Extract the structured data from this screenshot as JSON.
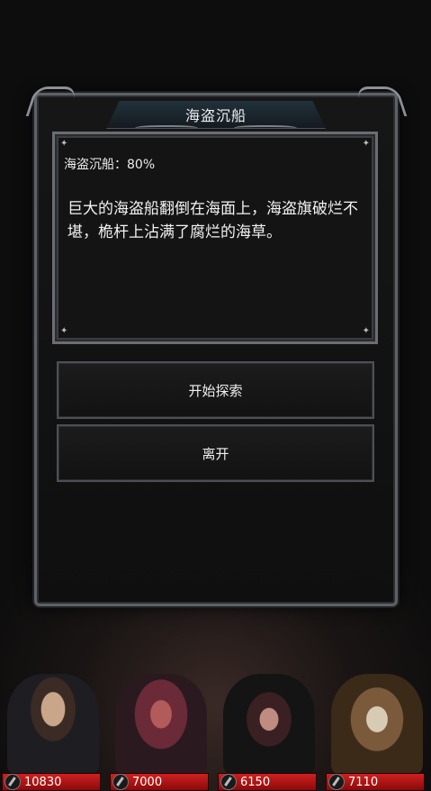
{
  "dialog": {
    "title": "海盗沉船",
    "rate_line": "海盗沉船：80%",
    "description": "巨大的海盗船翻倒在海面上，海盗旗破烂不堪，桅杆上沾满了腐烂的海草。"
  },
  "actions": {
    "explore_label": "开始探索",
    "leave_label": "离开"
  },
  "party": [
    {
      "hp": "10830",
      "icon": "sword-icon"
    },
    {
      "hp": "7000",
      "icon": "sword-icon"
    },
    {
      "hp": "6150",
      "icon": "sword-icon"
    },
    {
      "hp": "7110",
      "icon": "sword-icon"
    }
  ]
}
